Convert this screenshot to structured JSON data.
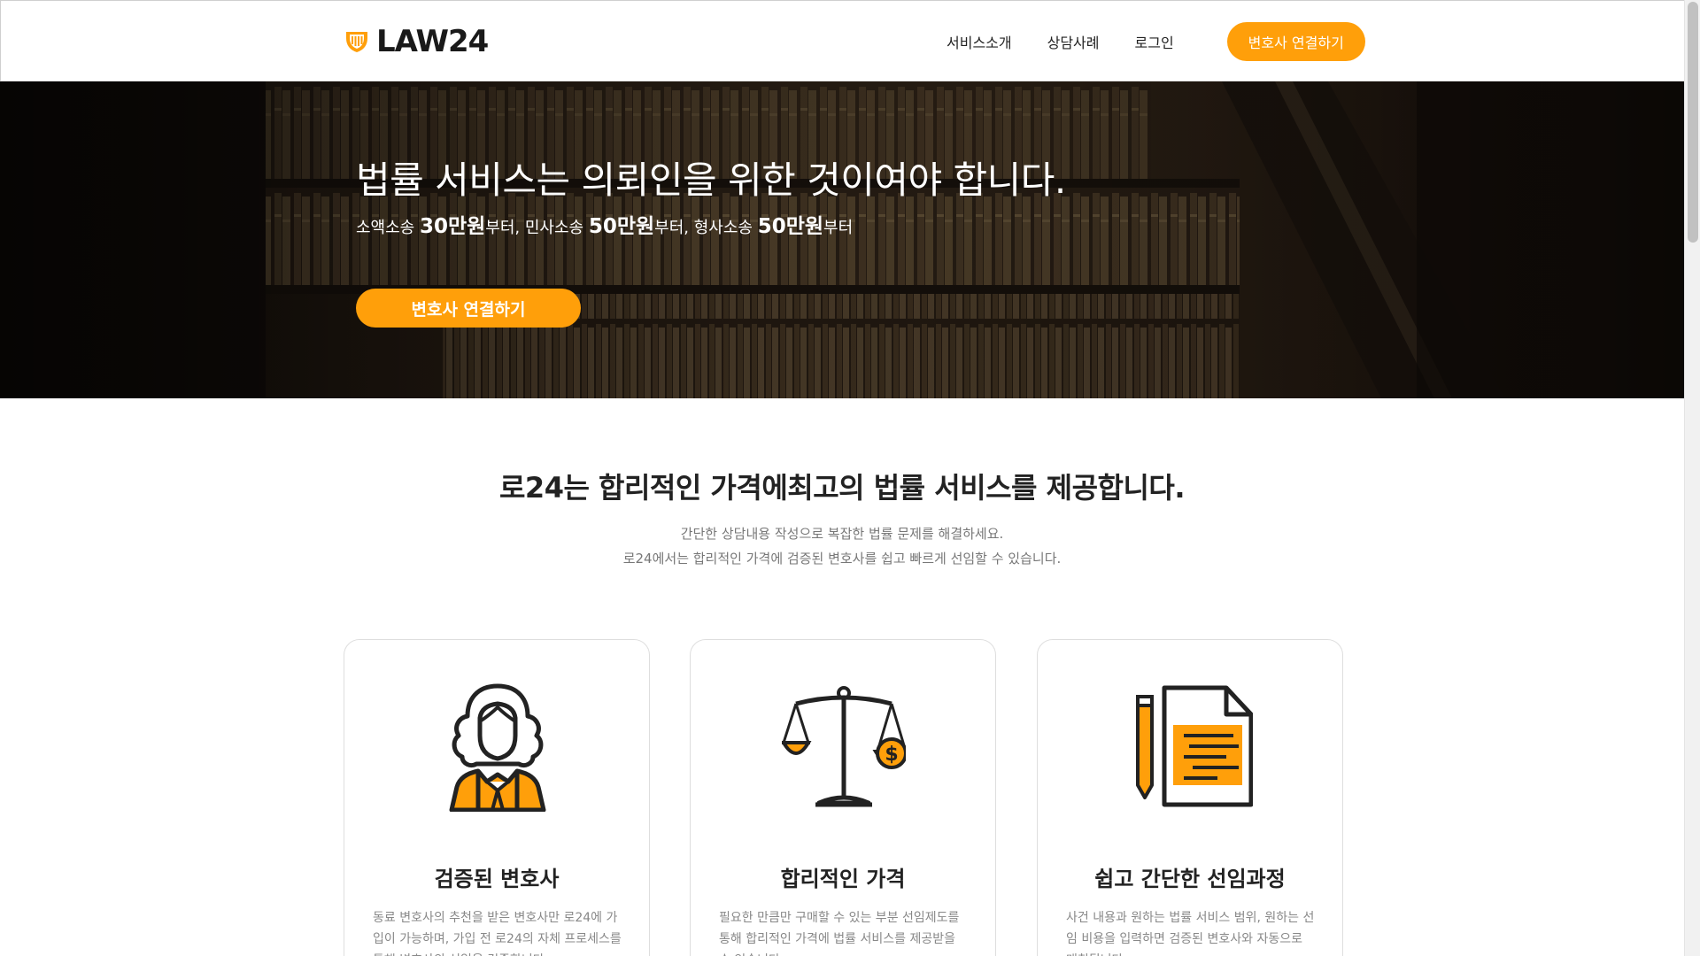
{
  "header": {
    "logo_text": "LAW24",
    "nav": [
      "서비스소개",
      "상담사례",
      "로그인"
    ],
    "cta_label": "변호사 연결하기"
  },
  "hero": {
    "title": "법률 서비스는 의뢰인을 위한 것이여야 합니다.",
    "sub": {
      "p1": "소액소송 ",
      "v1": "30만원",
      "s1": "부터, ",
      "p2": "민사소송 ",
      "v2": "50만원",
      "s2": "부터, ",
      "p3": "형사소송 ",
      "v3": "50만원",
      "s3": "부터"
    },
    "cta_label": "변호사 연결하기"
  },
  "intro": {
    "title": "로24는 합리적인 가격에최고의 법률 서비스를 제공합니다.",
    "line1": "간단한 상담내용 작성으로 복잡한 법률 문제를 해결하세요.",
    "line2": "로24에서는 합리적인 가격에 검증된 변호사를 쉽고 빠르게 선임할 수 있습니다."
  },
  "cards": [
    {
      "icon": "lawyer-icon",
      "title": "검증된 변호사",
      "desc": "동료 변호사의 추천을 받은 변호사만 로24에 가입이 가능하며, 가입 전 로24의 자체 프로세스를 통해 변호사의 선임을 검증합니다."
    },
    {
      "icon": "scales-icon",
      "title": "합리적인 가격",
      "desc": "필요한 만큼만 구매할 수 있는 부분 선임제도를 통해 합리적인 가격에 법률 서비스를 제공받을 수 있습니다."
    },
    {
      "icon": "document-icon",
      "title": "쉽고 간단한 선임과정",
      "desc": "사건 내용과 원하는 법률 서비스 범위, 원하는 선임 비용을 입력하면 검증된 변호사와 자동으로 매칭됩니다."
    }
  ],
  "colors": {
    "accent": "#ff9f0a",
    "text": "#222222",
    "muted": "#888888"
  }
}
